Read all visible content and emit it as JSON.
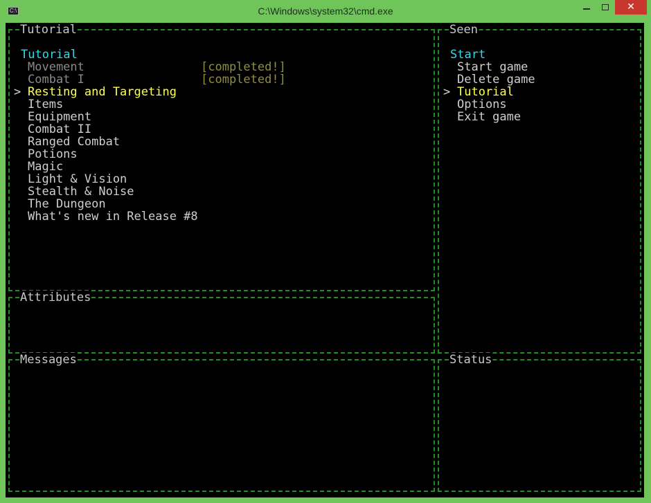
{
  "window": {
    "title": "C:\\Windows\\system32\\cmd.exe",
    "icon_label": "C:\\",
    "close_glyph": "✕"
  },
  "panels": {
    "tutorial": {
      "title": "Tutorial"
    },
    "seen": {
      "title": "Seen"
    },
    "attributes": {
      "title": "Attributes"
    },
    "messages": {
      "title": "Messages"
    },
    "status": {
      "title": "Status"
    }
  },
  "tutorial_menu": {
    "heading": "Tutorial",
    "cursor": ">",
    "items": [
      {
        "label": "Movement",
        "status": "[completed!]",
        "state": "completed"
      },
      {
        "label": "Combat I",
        "status": "[completed!]",
        "state": "completed"
      },
      {
        "label": "Resting and Targeting",
        "status": "",
        "state": "selected"
      },
      {
        "label": "Items",
        "status": "",
        "state": "normal"
      },
      {
        "label": "Equipment",
        "status": "",
        "state": "normal"
      },
      {
        "label": "Combat II",
        "status": "",
        "state": "normal"
      },
      {
        "label": "Ranged Combat",
        "status": "",
        "state": "normal"
      },
      {
        "label": "Potions",
        "status": "",
        "state": "normal"
      },
      {
        "label": "Magic",
        "status": "",
        "state": "normal"
      },
      {
        "label": "Light & Vision",
        "status": "",
        "state": "normal"
      },
      {
        "label": "Stealth & Noise",
        "status": "",
        "state": "normal"
      },
      {
        "label": "The Dungeon",
        "status": "",
        "state": "normal"
      },
      {
        "label": "What's new in Release #8",
        "status": "",
        "state": "normal"
      }
    ]
  },
  "start_menu": {
    "heading": "Start",
    "cursor": ">",
    "items": [
      {
        "label": "Start game",
        "state": "normal"
      },
      {
        "label": "Delete game",
        "state": "normal"
      },
      {
        "label": "Tutorial",
        "state": "selected"
      },
      {
        "label": "Options",
        "state": "normal"
      },
      {
        "label": "Exit game",
        "state": "normal"
      }
    ]
  },
  "colors": {
    "window_frame": "#6fc55a",
    "border": "#1f8c27",
    "heading": "#39d6e6",
    "selected": "#ffff55",
    "completed_label": "#8a8a8a",
    "completed_status": "#8f8f3b",
    "text": "#cfcfcf",
    "close_button": "#c7372d"
  }
}
